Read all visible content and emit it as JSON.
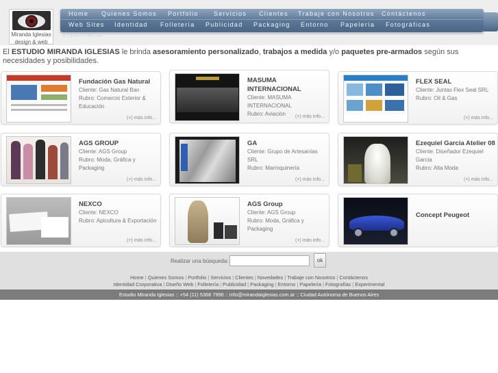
{
  "logo": {
    "line1": "Miranda Iglesias",
    "line2": "design & web"
  },
  "menu": {
    "row1": [
      "Home",
      "Quienes Somos",
      "Portfolio",
      "Servicios",
      "Clientes",
      "Trabaje con Nosotros",
      "Contáctenos"
    ],
    "row2": [
      "Web Sites",
      "Identidad",
      "Folletería",
      "Publicidad",
      "Packaging",
      "Entorno",
      "Papelería",
      "Fotográficas"
    ],
    "sub": "Experimental"
  },
  "intro": {
    "p1": "El ",
    "b1": "ESTUDIO MIRANDA IGLESIAS",
    "p2": " le brinda ",
    "b2": "asesoramiento personalizado",
    "p3": ", ",
    "b3": "trabajos a medida",
    "p4": " y/o ",
    "b4": "paquetes pre-armados",
    "p5": " según sus necesidades y posibilidades."
  },
  "cards": [
    {
      "title": "Fundación Gas Natural",
      "lines": [
        "Cliente: Gas Natural Ban",
        "Rubro: Comercio Exterior & Educación"
      ],
      "more": "(+) más info..."
    },
    {
      "title": "MASUMA INTERNACIONAL",
      "lines": [
        "Cliente: MASUMA INTERNACIONAL",
        "Rubro: Aviación"
      ],
      "more": "(+) más info..."
    },
    {
      "title": "FLEX SEAL",
      "lines": [
        "Cliente: Juntas Flex Seal SRL",
        "Rubro: Oil & Gas"
      ],
      "more": "(+) más info..."
    },
    {
      "title": "AGS GROUP",
      "lines": [
        "Cliente: AGS Group",
        "Rubro: Moda, Gráfica y Packaging"
      ],
      "more": "(+) más info..."
    },
    {
      "title": "GA",
      "lines": [
        "Cliente: Grupo de Artesanías SRL",
        "Rubro: Marroquinería"
      ],
      "more": "(+) más info..."
    },
    {
      "title": "Ezequiel Garcia Atelier 08",
      "lines": [
        "Cliente: Diseñador Ezequiel Garcia",
        "Rubro: Alta Moda"
      ],
      "more": "(+) más info..."
    },
    {
      "title": "NEXCO",
      "lines": [
        "Cliente: NEXCO",
        "Rubro: Apicultura & Exportación"
      ],
      "more": "(+) más info..."
    },
    {
      "title": "AGS Group",
      "lines": [
        "Cliente: AGS Group",
        "Rubro: Moda, Gráfica y Packaging"
      ],
      "more": "(+) más info..."
    },
    {
      "title": "Concept Peugeot",
      "lines": [],
      "more": ""
    }
  ],
  "search": {
    "label": "Realizar una búsqueda:",
    "value": "",
    "button": "ok"
  },
  "footer": {
    "row1": [
      "Home",
      "Quienes Somos",
      "Portfolio",
      "Servicios",
      "Clientes",
      "Novedades",
      "Trabaje con Nosotros",
      "Contáctenos"
    ],
    "row2": [
      "Identidad Corporativa",
      "Diseño Web",
      "Folletería",
      "Publicidad",
      "Packaging",
      "Entorno",
      "Papelería",
      "Fotografías",
      "Experimental"
    ],
    "contact": "Estudio Miranda Iglesias :: +54 (11) 5368 7996 :: info@mirandaiglesias.com.ar :: Ciudad Autónoma de Buenos Aires"
  },
  "colors": {
    "menu": "#5c7797",
    "footer": "#7c7c7c",
    "band": "#e0e0e0"
  }
}
